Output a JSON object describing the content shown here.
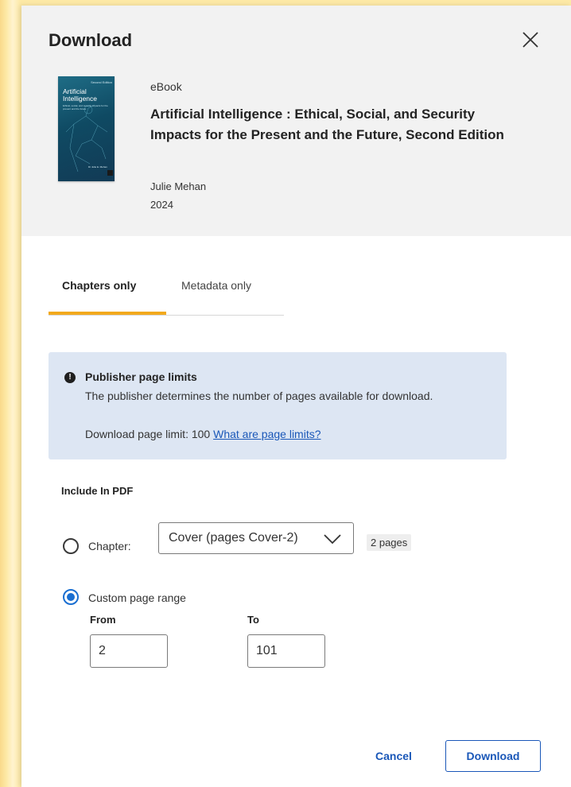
{
  "dialog": {
    "title": "Download",
    "close_label": "Close"
  },
  "book": {
    "type": "eBook",
    "title": "Artificial Intelligence : Ethical, Social, and Security Impacts for the Present and the Future, Second Edition",
    "author": "Julie Mehan",
    "year": "2024",
    "cover": {
      "edition_tag": "Second Edition",
      "title_line1": "Artificial",
      "title_line2": "Intelligence",
      "subtitle": "Ethical, social, and security impacts for the present and the future",
      "author": "Dr Julie E. Mehan"
    }
  },
  "tabs": [
    {
      "label": "Chapters only",
      "selected": true
    },
    {
      "label": "Metadata only",
      "selected": false
    }
  ],
  "notice": {
    "icon": "exclamation-icon",
    "title": "Publisher page limits",
    "text": "The publisher determines the number of pages available for download.",
    "limit_text": "Download page limit: 100",
    "link_text": "What are page limits?"
  },
  "include": {
    "label": "Include In PDF",
    "chapter_option": {
      "label": "Chapter:",
      "selected": false,
      "select_value": "Cover (pages Cover-2)",
      "pages_badge": "2 pages"
    },
    "custom_option": {
      "label": "Custom page range",
      "selected": true,
      "from_label": "From",
      "from_value": "2",
      "to_label": "To",
      "to_value": "101"
    }
  },
  "actions": {
    "cancel_label": "Cancel",
    "download_label": "Download"
  },
  "colors": {
    "accent": "#f2a91d",
    "link": "#1a57b8",
    "radio_selected": "#1a6fd1",
    "notice_bg": "#dde6f3"
  }
}
